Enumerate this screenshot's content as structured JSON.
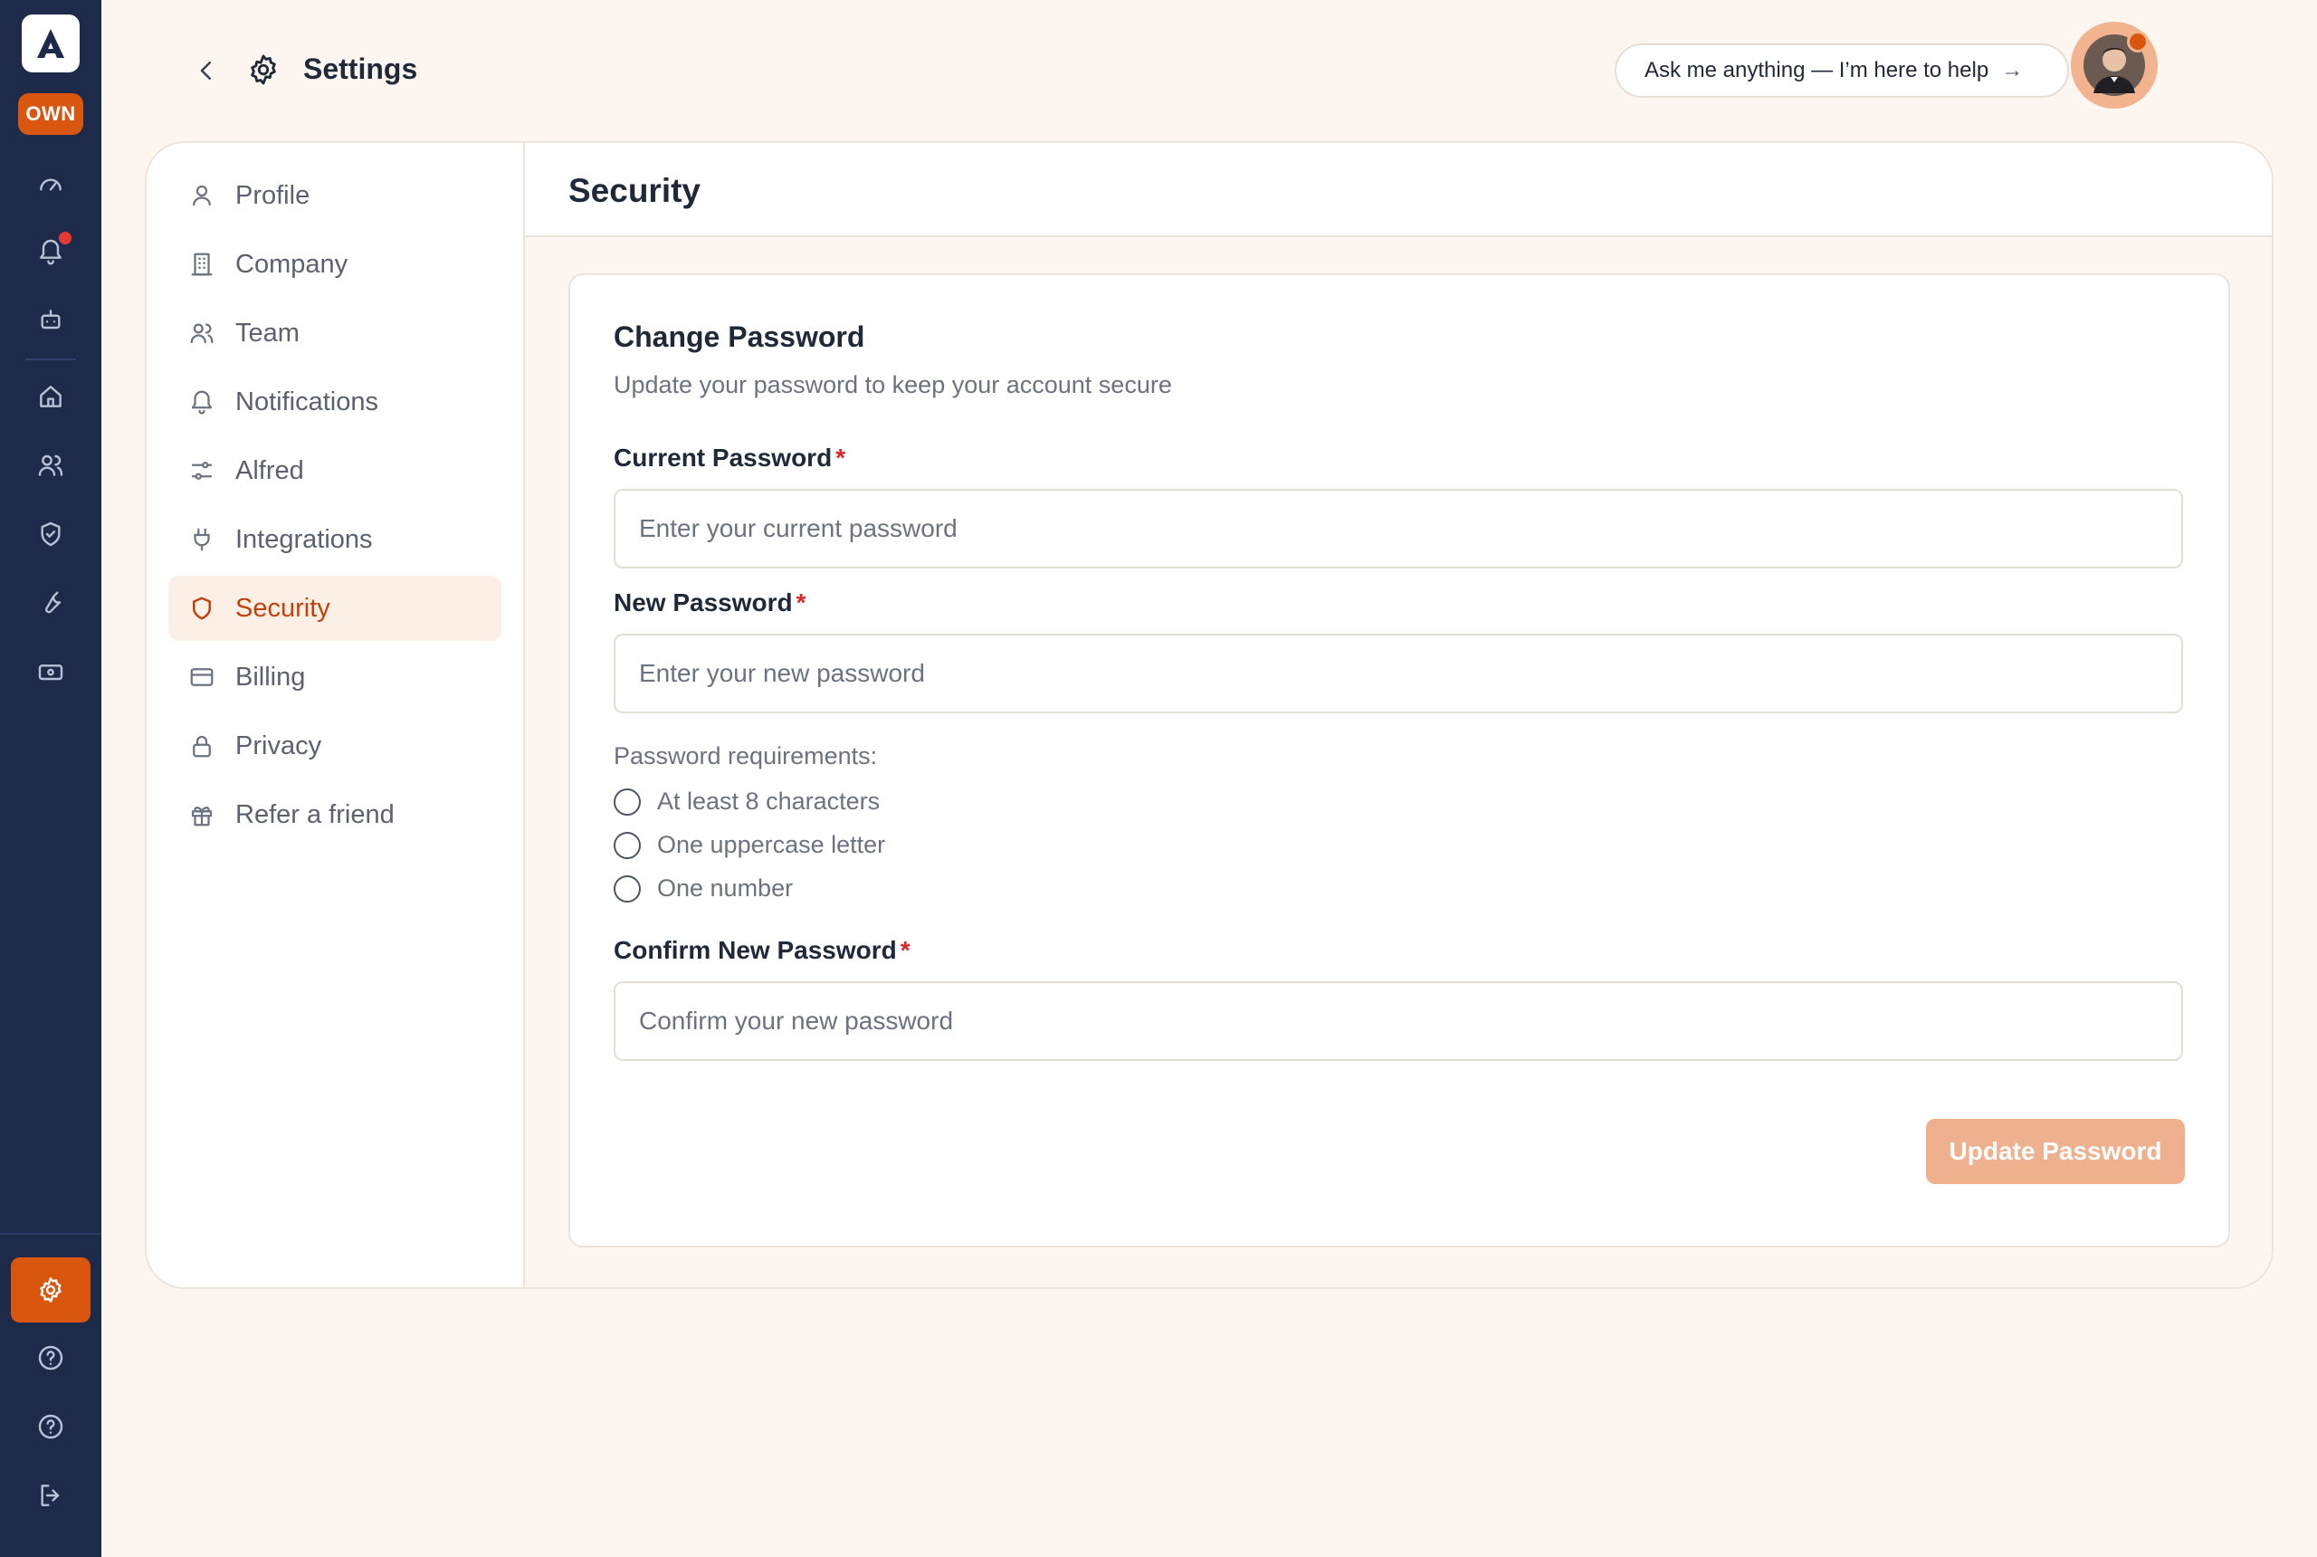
{
  "rail": {
    "badge_label": "OWN",
    "icons": [
      "logo-icon",
      "dashboard-icon",
      "notifications-icon",
      "robot-icon",
      "home-icon",
      "users-icon",
      "shield-icon",
      "wrench-icon",
      "money-icon",
      "settings-icon",
      "help-icon",
      "help-icon",
      "logout-icon"
    ]
  },
  "header": {
    "title": "Settings",
    "ask_label": "Ask me anything — I’m here to help",
    "ask_arrow": "→"
  },
  "sidebar": {
    "items": [
      {
        "label": "Profile",
        "icon": "user-icon"
      },
      {
        "label": "Company",
        "icon": "building-icon"
      },
      {
        "label": "Team",
        "icon": "team-icon"
      },
      {
        "label": "Notifications",
        "icon": "bell-icon"
      },
      {
        "label": "Alfred",
        "icon": "sliders-icon"
      },
      {
        "label": "Integrations",
        "icon": "plug-icon"
      },
      {
        "label": "Security",
        "icon": "shield-icon",
        "active": true
      },
      {
        "label": "Billing",
        "icon": "credit-card-icon"
      },
      {
        "label": "Privacy",
        "icon": "lock-icon"
      },
      {
        "label": "Refer a friend",
        "icon": "gift-icon"
      }
    ]
  },
  "main": {
    "title": "Security",
    "panel": {
      "title": "Change Password",
      "subtitle": "Update your password to keep your account secure",
      "current_label": "Current Password",
      "current_placeholder": "Enter your current password",
      "new_label": "New Password",
      "new_placeholder": "Enter your new password",
      "requirements_title": "Password requirements:",
      "requirements": [
        "At least 8 characters",
        "One uppercase letter",
        "One number"
      ],
      "confirm_label": "Confirm New Password",
      "confirm_placeholder": "Confirm your new password",
      "required_mark": "*",
      "submit_label": "Update Password"
    }
  },
  "colors": {
    "accent": "#d9560f",
    "rail_bg": "#1e2a4a",
    "page_bg": "#fdf5ef",
    "active_nav_bg": "#fcefe6",
    "button_disabled": "#efb08e"
  }
}
